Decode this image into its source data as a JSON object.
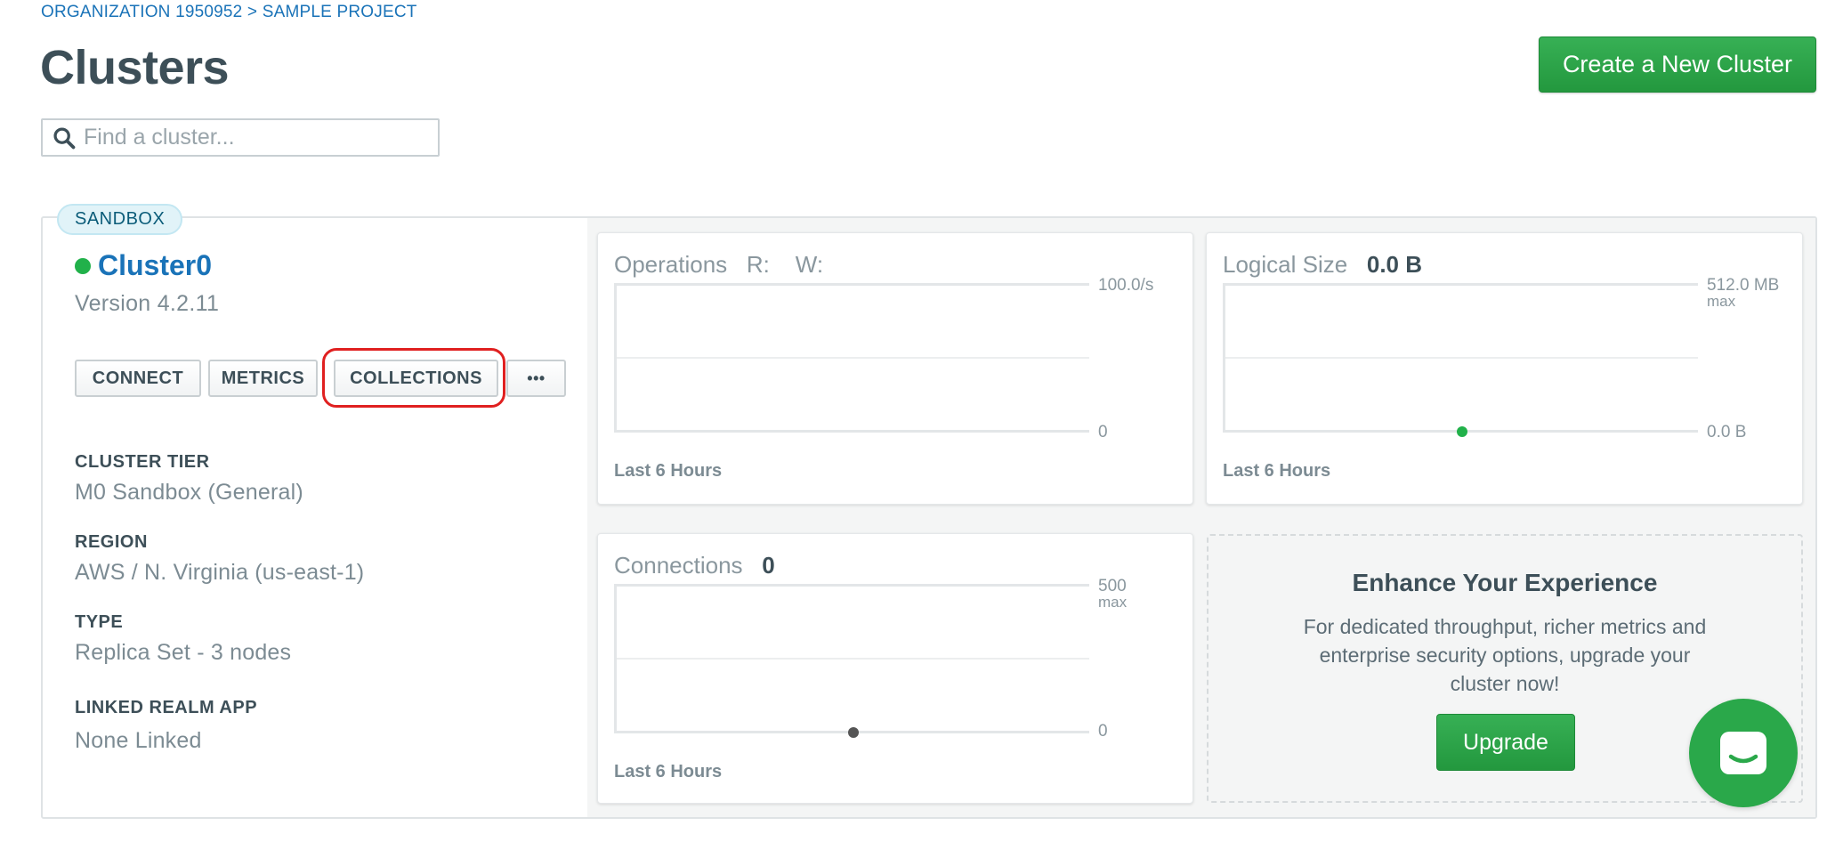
{
  "breadcrumb": "ORGANIZATION 1950952 > SAMPLE PROJECT",
  "page_title": "Clusters",
  "create_button": "Create a New Cluster",
  "search": {
    "placeholder": "Find a cluster..."
  },
  "cluster": {
    "badge": "SANDBOX",
    "name": "Cluster0",
    "status_color": "#21b14a",
    "version": "Version 4.2.11",
    "actions": {
      "connect": "CONNECT",
      "metrics": "METRICS",
      "collections": "COLLECTIONS",
      "more": "•••"
    },
    "details": [
      {
        "label": "CLUSTER TIER",
        "value": "M0 Sandbox (General)"
      },
      {
        "label": "REGION",
        "value": "AWS / N. Virginia (us-east-1)"
      },
      {
        "label": "TYPE",
        "value": "Replica Set - 3 nodes"
      },
      {
        "label": "LINKED REALM APP",
        "value": "None Linked"
      }
    ]
  },
  "panels": {
    "operations": {
      "title": "Operations",
      "r_label": "R:",
      "w_label": "W:",
      "max": "100.0/s",
      "min": "0",
      "footer": "Last 6 Hours"
    },
    "logical_size": {
      "title": "Logical Size",
      "value": "0.0 B",
      "max": "512.0 MB",
      "max_sub": "max",
      "min": "0.0 B",
      "footer": "Last 6 Hours",
      "point_color": "#21b14a",
      "point_position": 0.5
    },
    "connections": {
      "title": "Connections",
      "value": "0",
      "max": "500",
      "max_sub": "max",
      "min": "0",
      "footer": "Last 6 Hours",
      "point_color": "#555555",
      "point_position": 0.5
    }
  },
  "upsell": {
    "title": "Enhance Your Experience",
    "text": "For dedicated throughput, richer metrics and enterprise security options, upgrade your cluster now!",
    "button": "Upgrade"
  },
  "colors": {
    "accent_green": "#2ea44f",
    "link_blue": "#1a73b8",
    "highlight_red": "#e02020"
  },
  "icons": {
    "search": "search-icon",
    "chat": "chat-icon",
    "more": "more-dots-icon"
  }
}
